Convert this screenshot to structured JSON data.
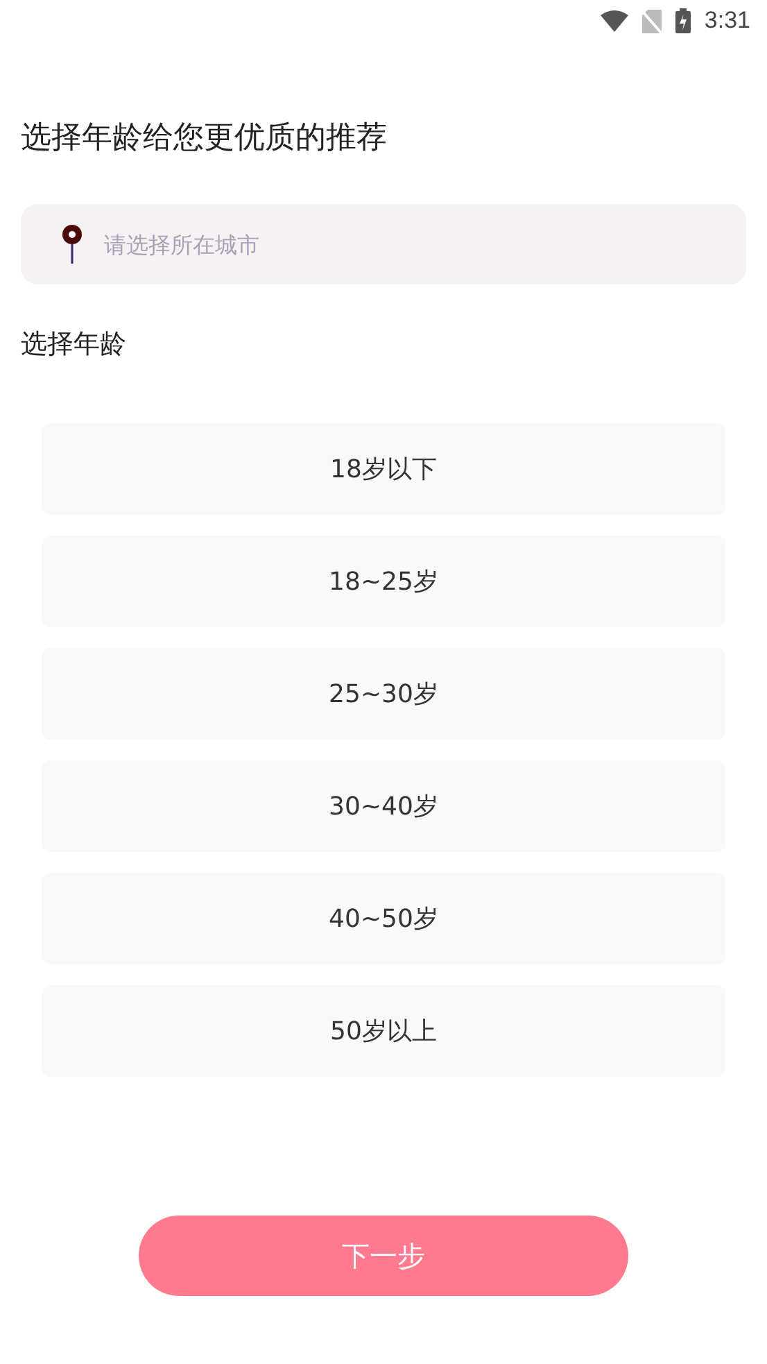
{
  "status_bar": {
    "time": "3:31"
  },
  "heading": "选择年龄给您更优质的推荐",
  "city_field": {
    "placeholder": "请选择所在城市"
  },
  "age_label": "选择年龄",
  "age_options": [
    {
      "label": "18岁以下",
      "selected": false
    },
    {
      "label": "18~25岁",
      "selected": false
    },
    {
      "label": "25~30岁",
      "selected": false
    },
    {
      "label": "30~40岁",
      "selected": false
    },
    {
      "label": "40~50岁",
      "selected": false
    },
    {
      "label": "50岁以上",
      "selected": false
    }
  ],
  "next_button": {
    "label": "下一步"
  }
}
